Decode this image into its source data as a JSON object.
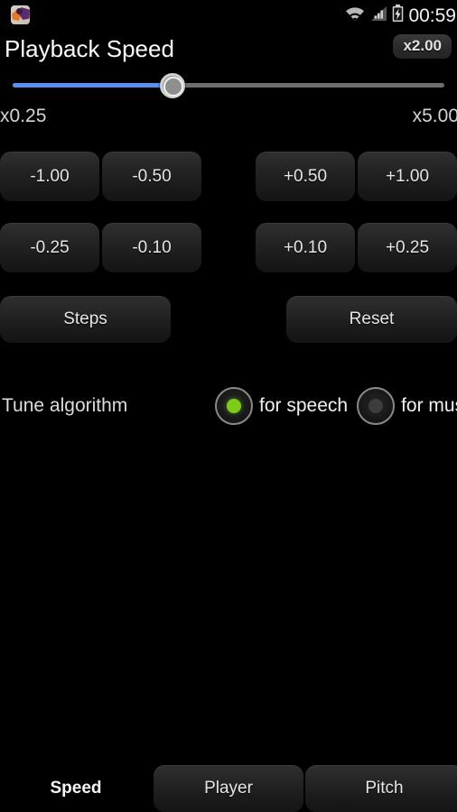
{
  "statusbar": {
    "app_icon": "app-launcher-icon",
    "wifi_icon": "wifi-icon",
    "signal_icon": "cellular-signal-icon",
    "battery_icon": "battery-charging-icon",
    "time": "00:59"
  },
  "header": {
    "title": "Playback Speed",
    "speed_badge": "x2.00"
  },
  "slider": {
    "min_label": "x0.25",
    "max_label": "x5.00",
    "min_value": 0.25,
    "max_value": 5.0,
    "current_value": 2.0,
    "fill_percent": 37,
    "fill_color": "#5a8ef0",
    "track_color": "#6e6e6e",
    "thumb_color": "#9a9a9a"
  },
  "step_buttons": {
    "row1": [
      "-1.00",
      "-0.50",
      "+0.50",
      "+1.00"
    ],
    "row2": [
      "-0.25",
      "-0.10",
      "+0.10",
      "+0.25"
    ]
  },
  "actions": {
    "steps_label": "Steps",
    "reset_label": "Reset"
  },
  "tune": {
    "label": "Tune algorithm",
    "options": [
      {
        "label": "for speech",
        "selected": true
      },
      {
        "label": "for music",
        "selected": false
      }
    ],
    "selected_color": "#7ccc18"
  },
  "tabs": [
    {
      "label": "Speed",
      "active": true
    },
    {
      "label": "Player",
      "active": false
    },
    {
      "label": "Pitch",
      "active": false
    }
  ]
}
